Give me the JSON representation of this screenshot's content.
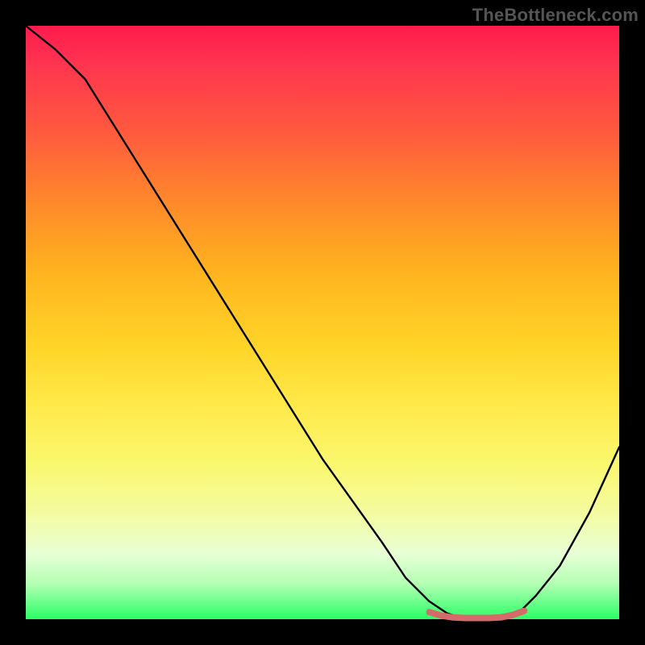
{
  "watermark": "TheBottleneck.com",
  "chart_data": {
    "type": "line",
    "title": "",
    "xlabel": "",
    "ylabel": "",
    "xlim": [
      0,
      100
    ],
    "ylim": [
      0,
      100
    ],
    "background_gradient": {
      "top_color": "#ff1a4d",
      "bottom_color": "#2aff66",
      "description": "vertical gradient red→orange→yellow→green over plot area"
    },
    "series": [
      {
        "name": "bottleneck-curve",
        "color": "#000000",
        "x": [
          0,
          5,
          10,
          15,
          20,
          25,
          30,
          35,
          40,
          45,
          50,
          55,
          60,
          64,
          68,
          71,
          74,
          77,
          80,
          83,
          86,
          90,
          95,
          100
        ],
        "y": [
          100,
          96,
          91,
          83,
          75,
          67,
          59,
          51,
          43,
          35,
          27,
          20,
          13,
          7,
          3,
          1,
          0,
          0,
          0,
          1,
          4,
          9,
          18,
          29
        ]
      },
      {
        "name": "optimal-band",
        "color": "#d46a6a",
        "description": "thicker red-ish segment marking near-zero region",
        "x": [
          68,
          70,
          72,
          74,
          76,
          78,
          80,
          82,
          84
        ],
        "y": [
          1.2,
          0.6,
          0.3,
          0.2,
          0.2,
          0.2,
          0.3,
          0.7,
          1.4
        ]
      }
    ]
  }
}
